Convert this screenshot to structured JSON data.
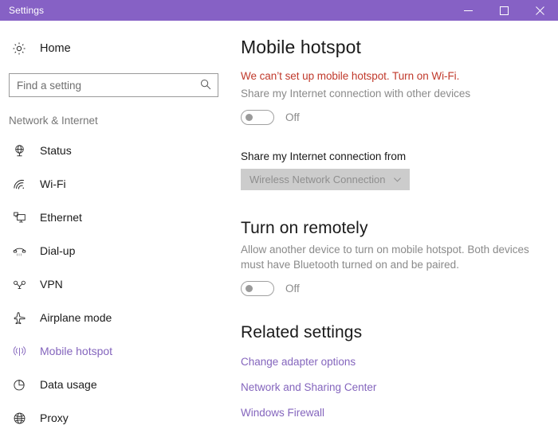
{
  "window": {
    "title": "Settings",
    "titlebar_color": "#8661c5",
    "controls": {
      "minimize": "minimize-button",
      "maximize": "maximize-button",
      "close": "close-button"
    }
  },
  "sidebar": {
    "home": {
      "label": "Home",
      "icon": "gear-icon"
    },
    "search": {
      "value": "",
      "placeholder": "Find a setting",
      "icon": "search-icon"
    },
    "category": "Network & Internet",
    "items": [
      {
        "label": "Status",
        "icon": "network-status-icon",
        "selected": false
      },
      {
        "label": "Wi-Fi",
        "icon": "wifi-icon",
        "selected": false
      },
      {
        "label": "Ethernet",
        "icon": "ethernet-icon",
        "selected": false
      },
      {
        "label": "Dial-up",
        "icon": "dialup-phone-icon",
        "selected": false
      },
      {
        "label": "VPN",
        "icon": "vpn-icon",
        "selected": false
      },
      {
        "label": "Airplane mode",
        "icon": "airplane-icon",
        "selected": false
      },
      {
        "label": "Mobile hotspot",
        "icon": "hotspot-signal-icon",
        "selected": true
      },
      {
        "label": "Data usage",
        "icon": "pie-chart-icon",
        "selected": false
      },
      {
        "label": "Proxy",
        "icon": "globe-icon",
        "selected": false
      }
    ],
    "selected_color": "#8465bd"
  },
  "main": {
    "title": "Mobile hotspot",
    "error_message": "We can’t set up mobile hotspot. Turn on Wi-Fi.",
    "error_color": "#c0392b",
    "share_description": "Share my Internet connection with other devices",
    "share_toggle": {
      "state": "Off",
      "enabled": false
    },
    "connection_from_label": "Share my Internet connection from",
    "connection_from_value": "Wireless Network Connection",
    "connection_from_chevron": "chevron-down-icon",
    "remote_section_title": "Turn on remotely",
    "remote_description": "Allow another device to turn on mobile hotspot. Both devices must have Bluetooth turned on and be paired.",
    "remote_toggle": {
      "state": "Off",
      "enabled": false
    },
    "related_title": "Related settings",
    "related_links": [
      "Change adapter options",
      "Network and Sharing Center",
      "Windows Firewall"
    ],
    "link_color": "#8465bd"
  }
}
